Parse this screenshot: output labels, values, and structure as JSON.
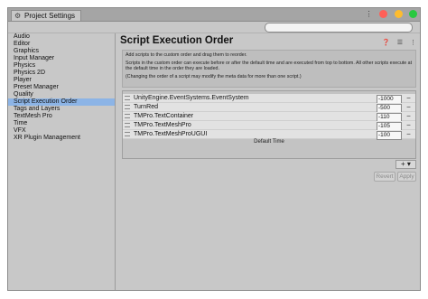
{
  "window": {
    "tab_title": "Project Settings",
    "icons": {
      "tab": "gear-icon",
      "menu": "kebab-menu-icon"
    },
    "buttons": {
      "close_color": "#ff5f57",
      "minimize_color": "#febc2e",
      "maximize_color": "#28c840"
    }
  },
  "search": {
    "placeholder": "",
    "value": ""
  },
  "sidebar": {
    "items": [
      {
        "label": "Audio"
      },
      {
        "label": "Editor"
      },
      {
        "label": "Graphics"
      },
      {
        "label": "Input Manager"
      },
      {
        "label": "Physics"
      },
      {
        "label": "Physics 2D"
      },
      {
        "label": "Player"
      },
      {
        "label": "Preset Manager"
      },
      {
        "label": "Quality"
      },
      {
        "label": "Script Execution Order"
      },
      {
        "label": "Tags and Layers"
      },
      {
        "label": "TextMesh Pro"
      },
      {
        "label": "Time"
      },
      {
        "label": "VFX"
      },
      {
        "label": "XR Plugin Management"
      }
    ],
    "selected": "Script Execution Order"
  },
  "main": {
    "title": "Script Execution Order",
    "info": {
      "line1": "Add scripts to the custom order and drag them to reorder.",
      "line2": "Scripts in the custom order can execute before or after the default time and are executed from top to bottom. All other scripts execute at the default time in the order they are loaded.",
      "line3": "(Changing the order of a script may modify the meta data for more than one script.)"
    },
    "scripts": [
      {
        "name": "UnityEngine.EventSystems.EventSystem",
        "order": "-1000"
      },
      {
        "name": "TurnRed",
        "order": "-500"
      },
      {
        "name": "TMPro.TextContainer",
        "order": "-110"
      },
      {
        "name": "TMPro.TextMeshPro",
        "order": "-105"
      },
      {
        "name": "TMPro.TextMeshProUGUI",
        "order": "-100"
      }
    ],
    "default_time_label": "Default Time",
    "add_label": "+ ▾",
    "revert_label": "Revert",
    "apply_label": "Apply"
  }
}
